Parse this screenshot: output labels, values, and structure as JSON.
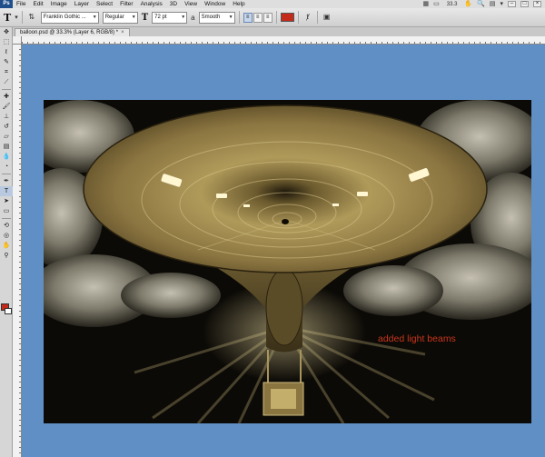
{
  "app": {
    "logo": "Ps"
  },
  "menu": {
    "items": [
      "File",
      "Edit",
      "Image",
      "Layer",
      "Select",
      "Filter",
      "Analysis",
      "3D",
      "View",
      "Window",
      "Help"
    ]
  },
  "menubar_right": {
    "zoom": "33.3"
  },
  "options": {
    "font_family": "Franklin Gothic ...",
    "font_style": "Regular",
    "font_size": "72 pt",
    "antialias": "Smooth",
    "text_color": "#c42a1a"
  },
  "document": {
    "tab_title": "balloon.psd @ 33.3% (Layer 6, RGB/8) *"
  },
  "canvas": {
    "annotation": "added light beams"
  },
  "colors": {
    "pasteboard": "#5f8fc4",
    "foreground": "#c42a1a",
    "background": "#ffffff"
  }
}
